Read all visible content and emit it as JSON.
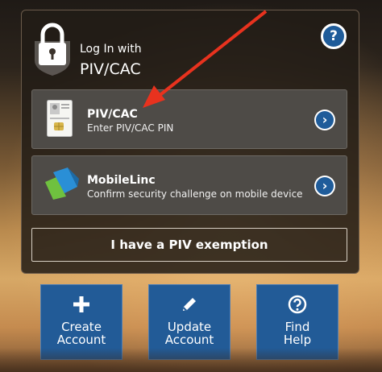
{
  "login": {
    "title_small": "Log In with",
    "title_large": "PIV/CAC"
  },
  "help_button": {
    "label": "?"
  },
  "options": [
    {
      "title": "PIV/CAC",
      "subtitle": "Enter PIV/CAC PIN",
      "icon": "smart-card-icon"
    },
    {
      "title": "MobileLinc",
      "subtitle": "Confirm security challenge on mobile device",
      "icon": "mobilelinc-icon"
    }
  ],
  "chevron_glyph": "›",
  "exemption_button": {
    "label": "I have a PIV exemption"
  },
  "tiles": [
    {
      "line1": "Create",
      "line2": "Account",
      "icon": "plus-icon"
    },
    {
      "line1": "Update",
      "line2": "Account",
      "icon": "pencil-icon"
    },
    {
      "line1": "Find",
      "line2": "Help",
      "icon": "question-circle-icon"
    }
  ],
  "colors": {
    "accent_blue": "#225b97",
    "annotation_arrow": "#e8321e"
  }
}
